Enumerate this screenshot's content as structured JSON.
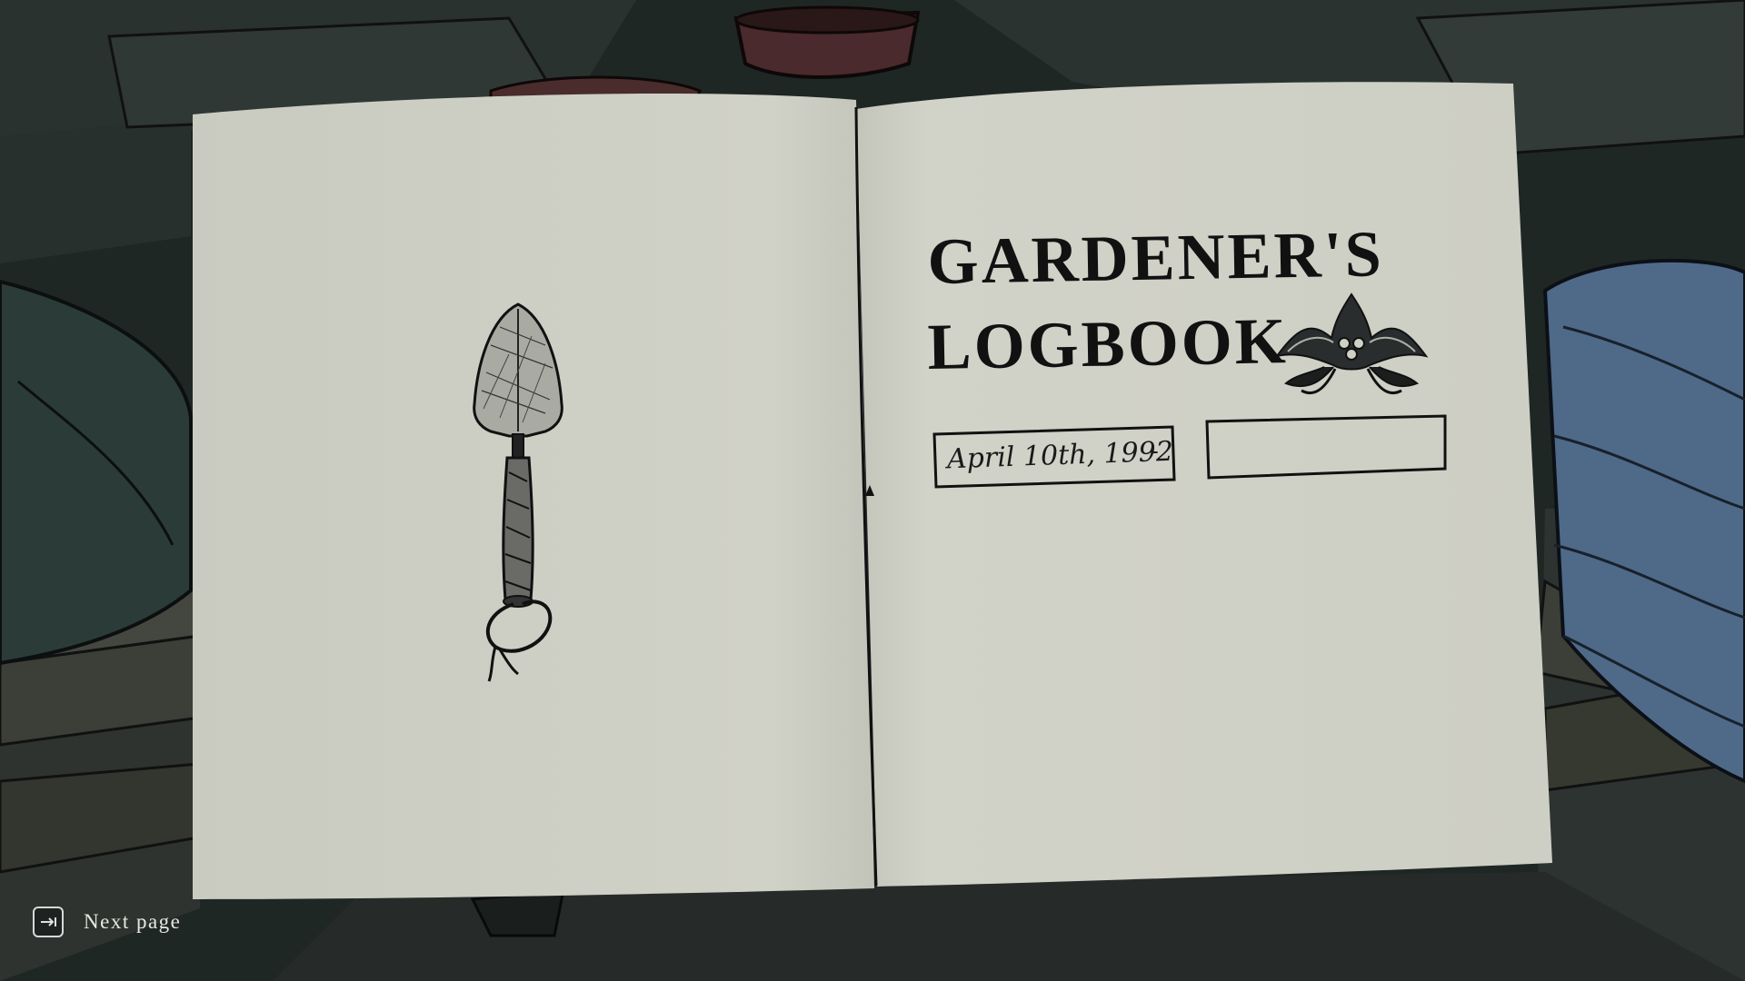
{
  "game": {
    "title_line1": "GARDENER'S",
    "title_line2": "LOGBOOK",
    "date_start": "April 10th, 1992",
    "date_separator": "-",
    "date_end": "",
    "illustration": "garden-trowel",
    "emblem": "holly-crest-icon"
  },
  "hud": {
    "next_page_label": "Next page",
    "next_page_key_icon": "tab-key-icon"
  },
  "colors": {
    "paper": "#cfd0c6",
    "ink": "#111111",
    "background": "#1d2523",
    "hud_text": "#e8e8e2"
  }
}
